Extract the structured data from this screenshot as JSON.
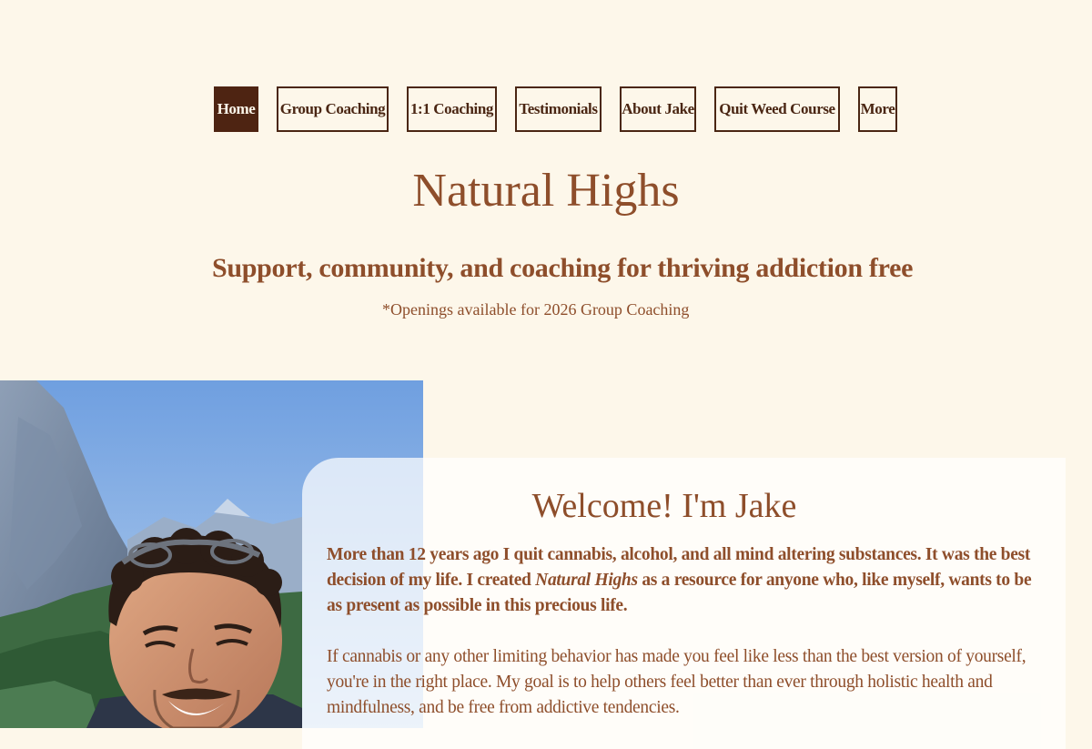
{
  "nav": {
    "items": [
      {
        "label": "Home",
        "active": true
      },
      {
        "label": "Group Coaching",
        "active": false
      },
      {
        "label": "1:1 Coaching",
        "active": false
      },
      {
        "label": "Testimonials",
        "active": false
      },
      {
        "label": "About Jake",
        "active": false
      },
      {
        "label": "Quit Weed Course",
        "active": false
      },
      {
        "label": "More",
        "active": false
      }
    ]
  },
  "hero": {
    "title": "Natural Highs",
    "tagline": "Support, community, and coaching for thriving addiction free",
    "openings": "*Openings available for 2026 Group Coaching"
  },
  "intro": {
    "heading": "Welcome! I'm Jake",
    "para1_before": "More than 12 years ago I quit cannabis, alcohol, and all mind altering substances. It was the best decision of my life. I created ",
    "para1_emphasis": "Natural Highs",
    "para1_after": " as a resource for anyone who, like myself, wants to be as present as possible in this precious life.",
    "para2": "If cannabis or any other limiting behavior has made you feel like less than the best version of yourself, you're in the right place. My goal is to help others feel better than ever through holistic health and mindfulness, and be free from addictive tendencies."
  },
  "colors": {
    "background": "#fdf7ea",
    "accent": "#8e4e2b",
    "nav_dark": "#4e2412",
    "card": "#ffffff"
  }
}
